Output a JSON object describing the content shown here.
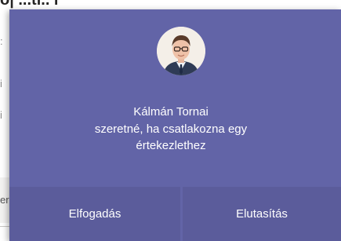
{
  "toast": {
    "caller_name": "Kálmán Tornai",
    "message_line1": "szeretné, ha csatlakozna egy",
    "message_line2": "értekezlethez",
    "accept_label": "Elfogadás",
    "decline_label": "Elutasítás",
    "background_color": "#6264a7",
    "button_color": "#5b5c9b",
    "avatar_icon": "user-photo"
  },
  "background_page": {
    "heading_fragment": "o| ...tl.. l",
    "fragment_1": ":",
    "fragment_2": "i",
    "fragment_3": "i",
    "fragment_4": "er"
  }
}
